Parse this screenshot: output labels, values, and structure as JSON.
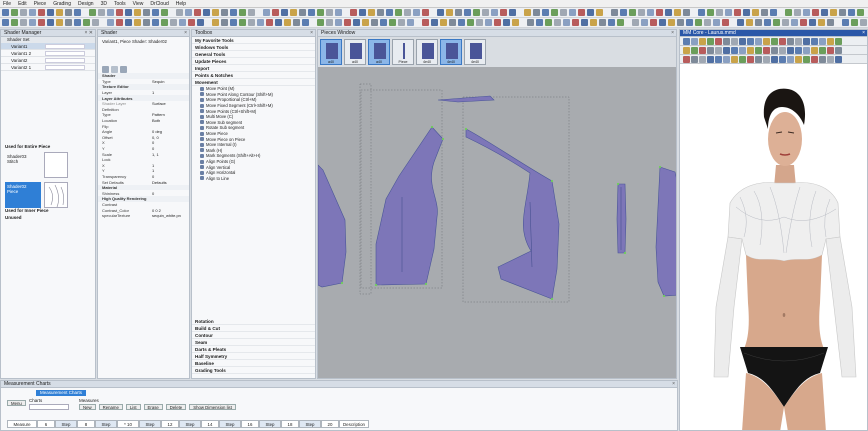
{
  "menu": [
    "File",
    "Edit",
    "Piece",
    "Grading",
    "Design",
    "3D",
    "Tools",
    "View",
    "DrCloud",
    "Help"
  ],
  "shader_manager": {
    "title": "Shader Manager",
    "header": "Shader Set",
    "rows": [
      {
        "label": "Variant1"
      },
      {
        "label": "Variant1 2"
      },
      {
        "label": "Variant2"
      },
      {
        "label": "Variant2 1"
      }
    ],
    "used_entire": "Used for Entire Piece",
    "thumbs": [
      {
        "label": "Shader03 Stitch"
      },
      {
        "label": "Shader02 Piece"
      }
    ],
    "used_inner": "Used for Inner Piece",
    "unused": "Unused"
  },
  "shader_props": {
    "title": "Shader",
    "subtitle": "Variant1, Piece Shader: Shader02",
    "rows": [
      {
        "k": "Shader",
        "v": "",
        "sec": true
      },
      {
        "k": "Type",
        "v": "Sequin"
      },
      {
        "k": "Texture Editor",
        "v": "",
        "sec": true
      },
      {
        "k": "Layer",
        "v": "1"
      },
      {
        "k": "Layer Attributes",
        "v": "",
        "sec": true
      },
      {
        "k": "Shader Layer",
        "v": "Surface",
        "dim": true
      },
      {
        "k": "Definition",
        "v": ""
      },
      {
        "k": "Type",
        "v": "Pattern"
      },
      {
        "k": "Location",
        "v": "Both"
      },
      {
        "k": "Flip",
        "v": ""
      },
      {
        "k": "Angle",
        "v": "0 deg"
      },
      {
        "k": "Offset",
        "v": "0, 0"
      },
      {
        "k": "X",
        "v": "0"
      },
      {
        "k": "Y",
        "v": "0"
      },
      {
        "k": "Scale",
        "v": "1, 1"
      },
      {
        "k": "Lock",
        "v": ""
      },
      {
        "k": "X",
        "v": "1"
      },
      {
        "k": "Y",
        "v": "1"
      },
      {
        "k": "Transparency",
        "v": "0"
      },
      {
        "k": "Set Defaults",
        "v": "Defaults"
      },
      {
        "k": "Material",
        "v": "",
        "sec": true
      },
      {
        "k": "Shininess",
        "v": "0"
      },
      {
        "k": "High Quality Rendering",
        "v": "",
        "sec": true
      },
      {
        "k": "Contrast",
        "v": ""
      },
      {
        "k": "Contrast_Color",
        "v": "0 0 2"
      },
      {
        "k": "specularTexture",
        "v": "sequin_white.pn"
      }
    ]
  },
  "toolbox": {
    "title": "Toolbox",
    "categories_top": [
      "My Favorite Tools",
      "Windows Tools",
      "General Tools",
      "Update Pieces",
      "Import",
      "Points & Notches",
      "Movement"
    ],
    "items": [
      "Move Point (M)",
      "Move Point Along Contour (Shift+M)",
      "Move Proportional (Ctrl+M)",
      "Move Fixed Segment (Ctrl+Shift+M)",
      "Move Points (Ctrl+Shift+M)",
      "Multi Move (C)",
      "Move Sub segment",
      "Rotate Sub segment",
      "Move Piece",
      "Move Piece on Piece",
      "Move Internal (I)",
      "Mark (H)",
      "Mark Segments (Shift+Alt+H)",
      "Align Points (G)",
      "Align Vertical",
      "Align Horizontal",
      "Align to Line"
    ],
    "categories_bottom": [
      "Rotation",
      "Build & Cut",
      "Contour",
      "Seam",
      "Darts & Pleats",
      "Half Symmetry",
      "Baseline",
      "Grading Tools"
    ]
  },
  "pieces_window": {
    "title": "Pieces Window",
    "thumbs": [
      {
        "label": "a40",
        "sel": true
      },
      {
        "label": "a40",
        "sel": false
      },
      {
        "label": "a40",
        "sel": true
      },
      {
        "label": "Piece",
        "sel": false
      },
      {
        "label": "4e40",
        "sel": false
      },
      {
        "label": "4e40",
        "sel": true
      },
      {
        "label": "4e40",
        "sel": false
      }
    ]
  },
  "viewer3d": {
    "title": "MM Core - Laurus.mmd"
  },
  "measurement": {
    "title": "Measurement Charts",
    "tab": "Measurement Charts",
    "menu_btn": "Menu",
    "chart_label": "Charts",
    "measure_label": "Measures",
    "buttons": [
      "New",
      "Rename",
      "List",
      "Erase",
      "Delete",
      "Show Dimension list"
    ],
    "row": [
      "Measure",
      "6",
      "Step",
      "8",
      "Step",
      "* 10",
      "Step",
      "12",
      "Step",
      "14",
      "Step",
      "16",
      "Step",
      "18",
      "Step",
      "20",
      "Description"
    ]
  },
  "colors": {
    "piece_fill": "#7d76b8",
    "piece_edge": "#4a5598",
    "canvas": "#a8abaf",
    "accent": "#2f7fd6"
  }
}
